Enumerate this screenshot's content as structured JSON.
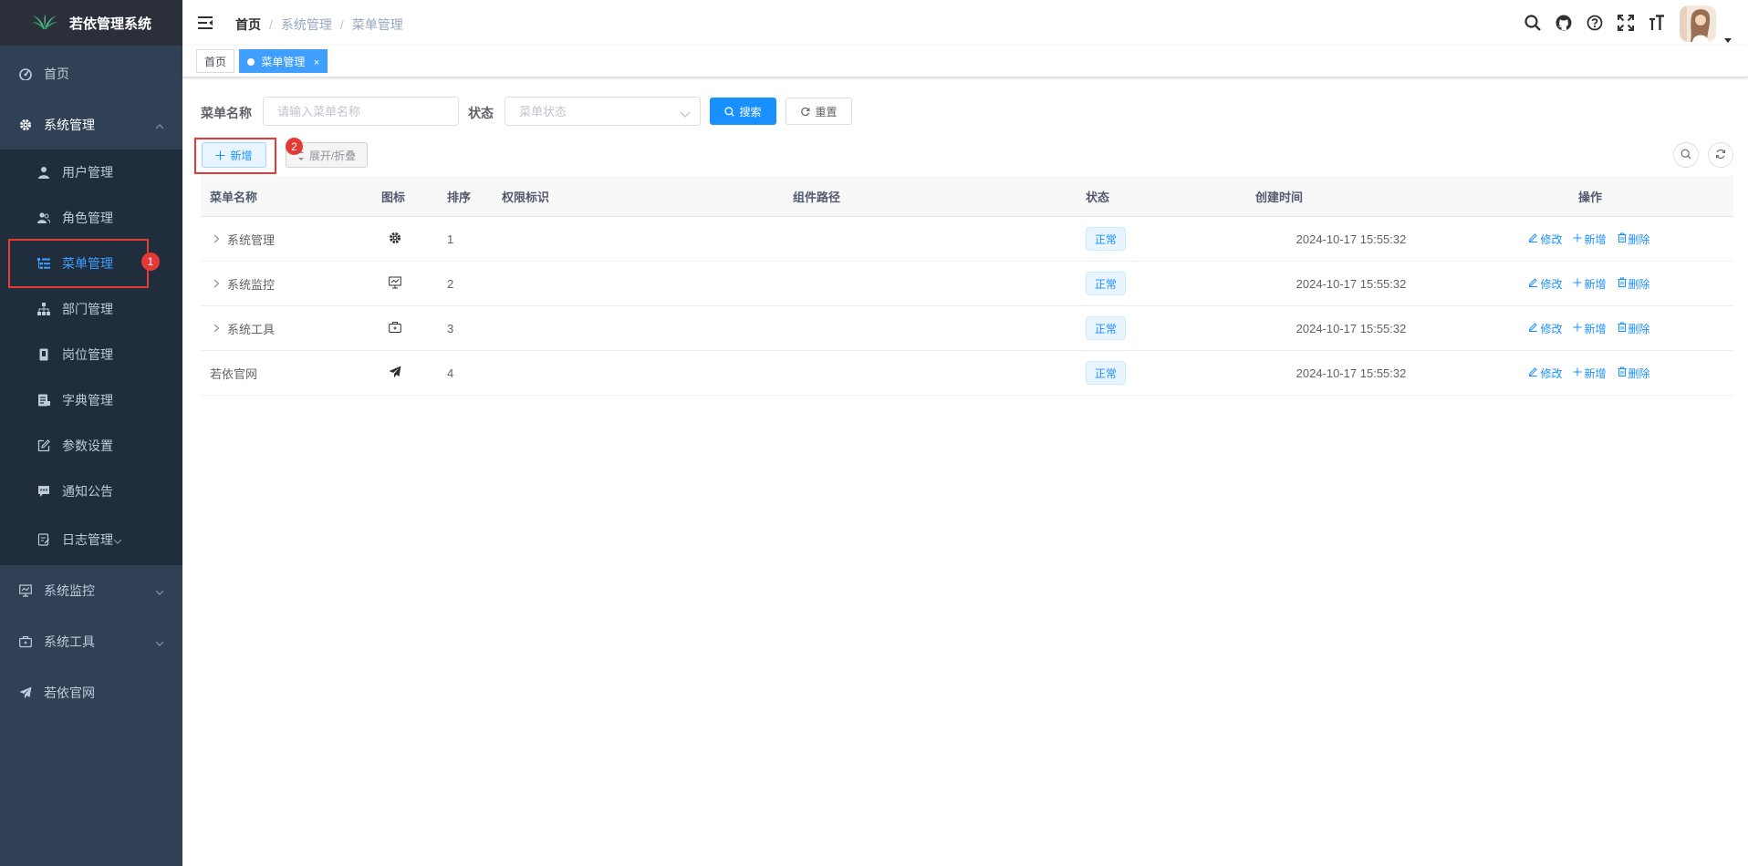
{
  "app": {
    "title": "若依管理系统"
  },
  "sidebar": {
    "items": [
      {
        "label": "首页",
        "icon": "dashboard-icon"
      },
      {
        "label": "系统管理",
        "icon": "gear-icon",
        "expanded": true,
        "children": [
          {
            "label": "用户管理",
            "icon": "user-icon"
          },
          {
            "label": "角色管理",
            "icon": "peoples-icon"
          },
          {
            "label": "菜单管理",
            "icon": "tree-table-icon",
            "active": true
          },
          {
            "label": "部门管理",
            "icon": "tree-icon"
          },
          {
            "label": "岗位管理",
            "icon": "post-icon"
          },
          {
            "label": "字典管理",
            "icon": "dict-icon"
          },
          {
            "label": "参数设置",
            "icon": "edit-icon"
          },
          {
            "label": "通知公告",
            "icon": "message-icon"
          },
          {
            "label": "日志管理",
            "icon": "log-icon"
          }
        ]
      },
      {
        "label": "系统监控",
        "icon": "monitor-icon"
      },
      {
        "label": "系统工具",
        "icon": "tool-icon"
      },
      {
        "label": "若依官网",
        "icon": "guide-icon"
      }
    ],
    "annotation_1": "1"
  },
  "navbar": {
    "breadcrumb": [
      "首页",
      "系统管理",
      "菜单管理"
    ],
    "separator": "/"
  },
  "tags": [
    {
      "label": "首页"
    },
    {
      "label": "菜单管理",
      "close": "×",
      "active": true
    }
  ],
  "search": {
    "name_label": "菜单名称",
    "name_placeholder": "请输入菜单名称",
    "status_label": "状态",
    "status_placeholder": "菜单状态",
    "search_button": "搜索",
    "reset_button": "重置"
  },
  "toolbar": {
    "add_button": "新增",
    "expand_button": "展开/折叠",
    "annotation_2": "2"
  },
  "table": {
    "headers": [
      "菜单名称",
      "图标",
      "排序",
      "权限标识",
      "组件路径",
      "状态",
      "创建时间",
      "操作"
    ],
    "rows": [
      {
        "name": "系统管理",
        "icon": "gear-icon",
        "order": "1",
        "perms": "",
        "component": "",
        "status": "正常",
        "created": "2024-10-17 15:55:32",
        "expandable": true
      },
      {
        "name": "系统监控",
        "icon": "monitor-icon",
        "order": "2",
        "perms": "",
        "component": "",
        "status": "正常",
        "created": "2024-10-17 15:55:32",
        "expandable": true
      },
      {
        "name": "系统工具",
        "icon": "tool-icon",
        "order": "3",
        "perms": "",
        "component": "",
        "status": "正常",
        "created": "2024-10-17 15:55:32",
        "expandable": true
      },
      {
        "name": "若依官网",
        "icon": "guide-icon",
        "order": "4",
        "perms": "",
        "component": "",
        "status": "正常",
        "created": "2024-10-17 15:55:32",
        "expandable": false
      }
    ],
    "ops": {
      "edit": "修改",
      "add": "新增",
      "delete": "删除"
    }
  },
  "colors": {
    "primary": "#1890ff",
    "sidebar_bg": "#304156",
    "submenu_bg": "#1f2d3d",
    "active_text": "#409eff",
    "annotation": "#e53935"
  }
}
